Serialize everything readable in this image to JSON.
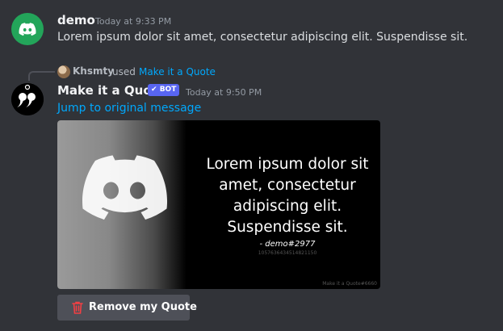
{
  "messages": [
    {
      "username": "demo",
      "timestamp": "Today at 9:33 PM",
      "content": "Lorem ipsum dolor sit amet, consectetur adipiscing elit. Suspendisse sit.",
      "avatar_icon": "discord-logo-icon",
      "avatar_color": "#23a55a"
    },
    {
      "reply": {
        "user": "Khsmty",
        "used_text": "used",
        "command": "Make it a Quote"
      },
      "username": "Make it a Quote",
      "bot_tag": "BOT",
      "timestamp": "Today at 9:50 PM",
      "jump_link": "Jump to original message",
      "avatar_icon": "quote-marks-icon",
      "quote_image": {
        "quote_text": "Lorem ipsum dolor sit amet, consectetur adipiscing elit. Suspendisse sit.",
        "author": "- demo#2977",
        "user_id": "1057636434514821150",
        "watermark": "Make it a Quote#6660"
      },
      "button": {
        "label": "Remove my Quote",
        "icon": "trash-icon",
        "icon_color": "#f23f43"
      }
    }
  ],
  "colors": {
    "background": "#313338",
    "link": "#00a8fc",
    "bot_tag": "#5865f2",
    "button_bg": "#4e5058"
  }
}
